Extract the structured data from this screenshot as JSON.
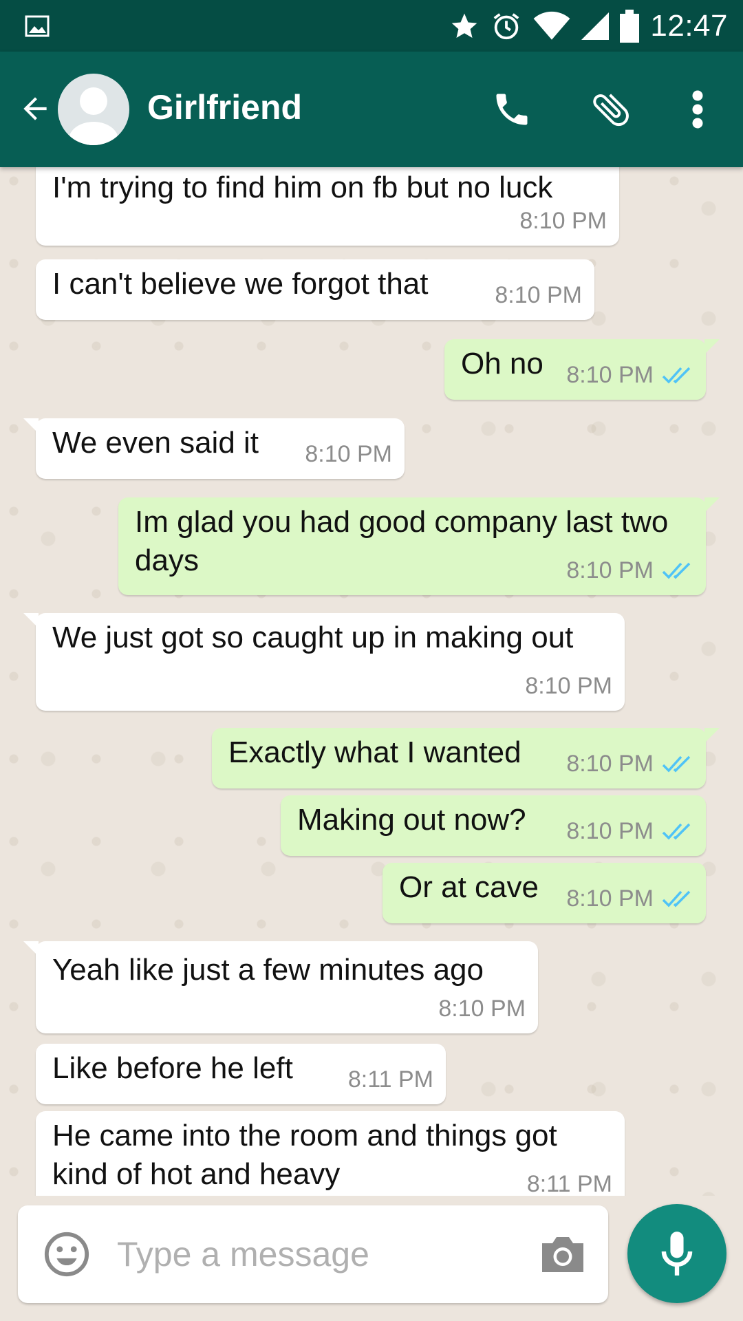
{
  "status_bar": {
    "time": "12:47",
    "icons": [
      "gallery-icon",
      "star-icon",
      "alarm-icon",
      "wifi-icon",
      "signal-icon",
      "battery-icon"
    ]
  },
  "header": {
    "contact_name": "Girlfriend",
    "icons": [
      "back-arrow-icon",
      "avatar-icon",
      "phone-icon",
      "paperclip-icon",
      "more-vert-icon"
    ]
  },
  "messages": [
    {
      "direction": "in",
      "text": "I'm trying to find him on fb but no luck",
      "time": "8:10 PM"
    },
    {
      "direction": "in",
      "text": "I can't believe we forgot that",
      "time": "8:10 PM"
    },
    {
      "direction": "out",
      "text": "Oh no",
      "time": "8:10 PM",
      "status": "read"
    },
    {
      "direction": "in",
      "text": "We even said it",
      "time": "8:10 PM"
    },
    {
      "direction": "out",
      "text": "Im glad you had good company last two days",
      "time": "8:10 PM",
      "status": "read"
    },
    {
      "direction": "in",
      "text": "We just got so caught up in making out",
      "time": "8:10 PM"
    },
    {
      "direction": "out",
      "text": "Exactly what I wanted",
      "time": "8:10 PM",
      "status": "read"
    },
    {
      "direction": "out",
      "text": "Making out now?",
      "time": "8:10 PM",
      "status": "read"
    },
    {
      "direction": "out",
      "text": "Or at cave",
      "time": "8:10 PM",
      "status": "read"
    },
    {
      "direction": "in",
      "text": "Yeah like just a few minutes ago",
      "time": "8:10 PM"
    },
    {
      "direction": "in",
      "text": "Like before he left",
      "time": "8:11 PM"
    },
    {
      "direction": "in",
      "text": "He came into the room and things got kind of hot and heavy",
      "time": "8:11 PM"
    }
  ],
  "composer": {
    "placeholder": "Type a message",
    "icons": [
      "emoji-icon",
      "camera-icon",
      "mic-icon"
    ]
  },
  "colors": {
    "status_bar": "#054d44",
    "toolbar": "#075e54",
    "outgoing_bubble": "#dcf8c6",
    "incoming_bubble": "#ffffff",
    "read_ticks": "#4fc3f7",
    "mic_button": "#128c7e",
    "chat_background": "#ece5dd"
  }
}
